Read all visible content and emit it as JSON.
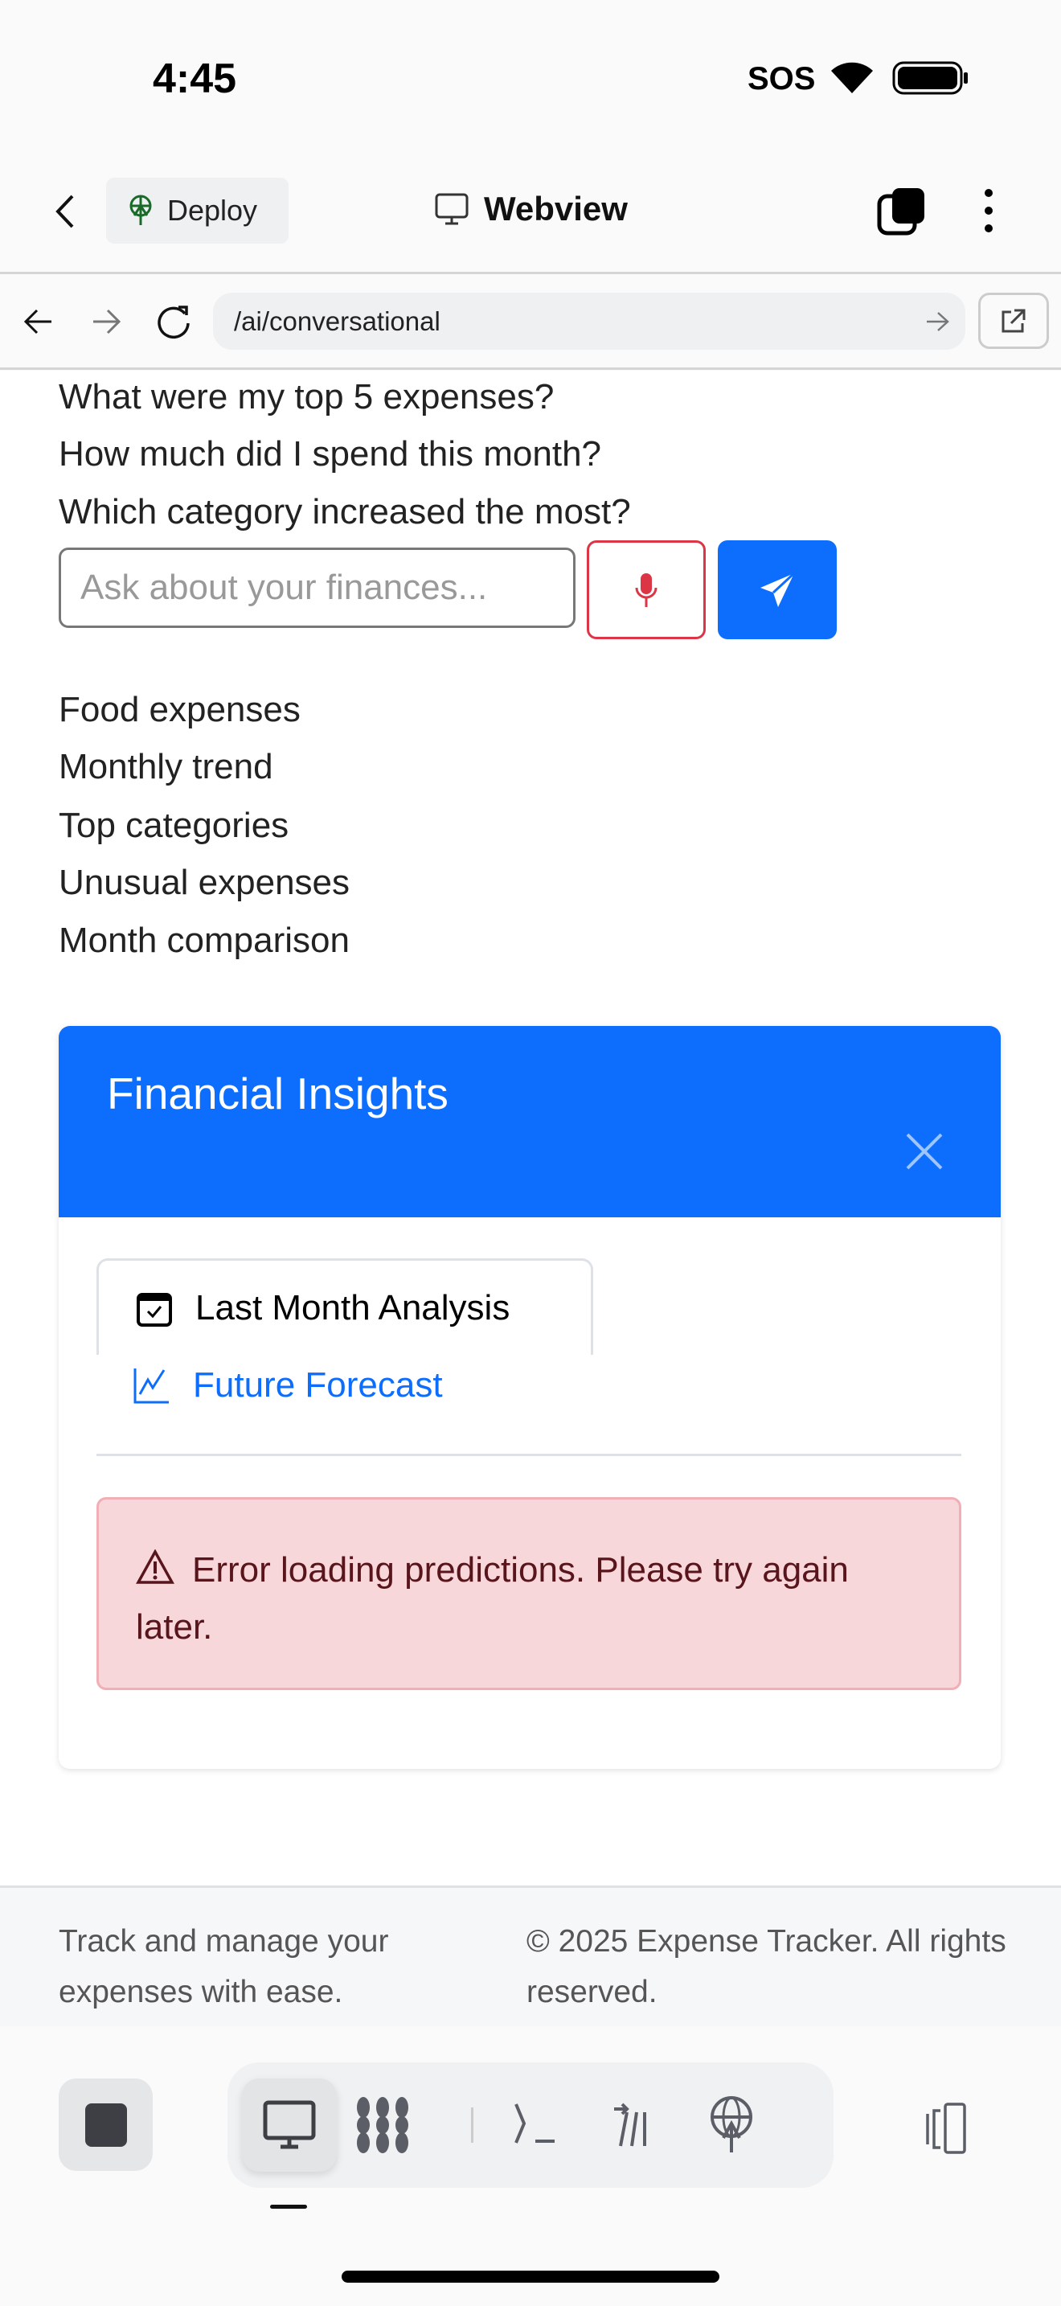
{
  "status": {
    "time": "4:45",
    "sos": "SOS"
  },
  "header": {
    "deploy_label": "Deploy",
    "title": "Webview"
  },
  "browser": {
    "url": "/ai/conversational"
  },
  "chat": {
    "questions": [
      "What were my top 5 expenses?",
      "How much did I spend this month?",
      "Which category increased the most?"
    ],
    "input_placeholder": "Ask about your finances...",
    "suggestions": [
      "Food expenses",
      "Monthly trend",
      "Top categories",
      "Unusual expenses",
      "Month comparison"
    ]
  },
  "insights": {
    "title": "Financial Insights",
    "tabs": [
      {
        "label": "Last Month Analysis",
        "icon": "calendar-check-icon"
      },
      {
        "label": "Future Forecast",
        "icon": "graph-up-icon"
      }
    ],
    "error": "Error loading predictions. Please try again later."
  },
  "footer": {
    "left": "Track and manage your expenses with ease.",
    "right": "© 2025 Expense Tracker. All rights reserved."
  },
  "colors": {
    "primary": "#0d6efd",
    "danger": "#dc3545",
    "alert_bg": "#f8d7da"
  }
}
